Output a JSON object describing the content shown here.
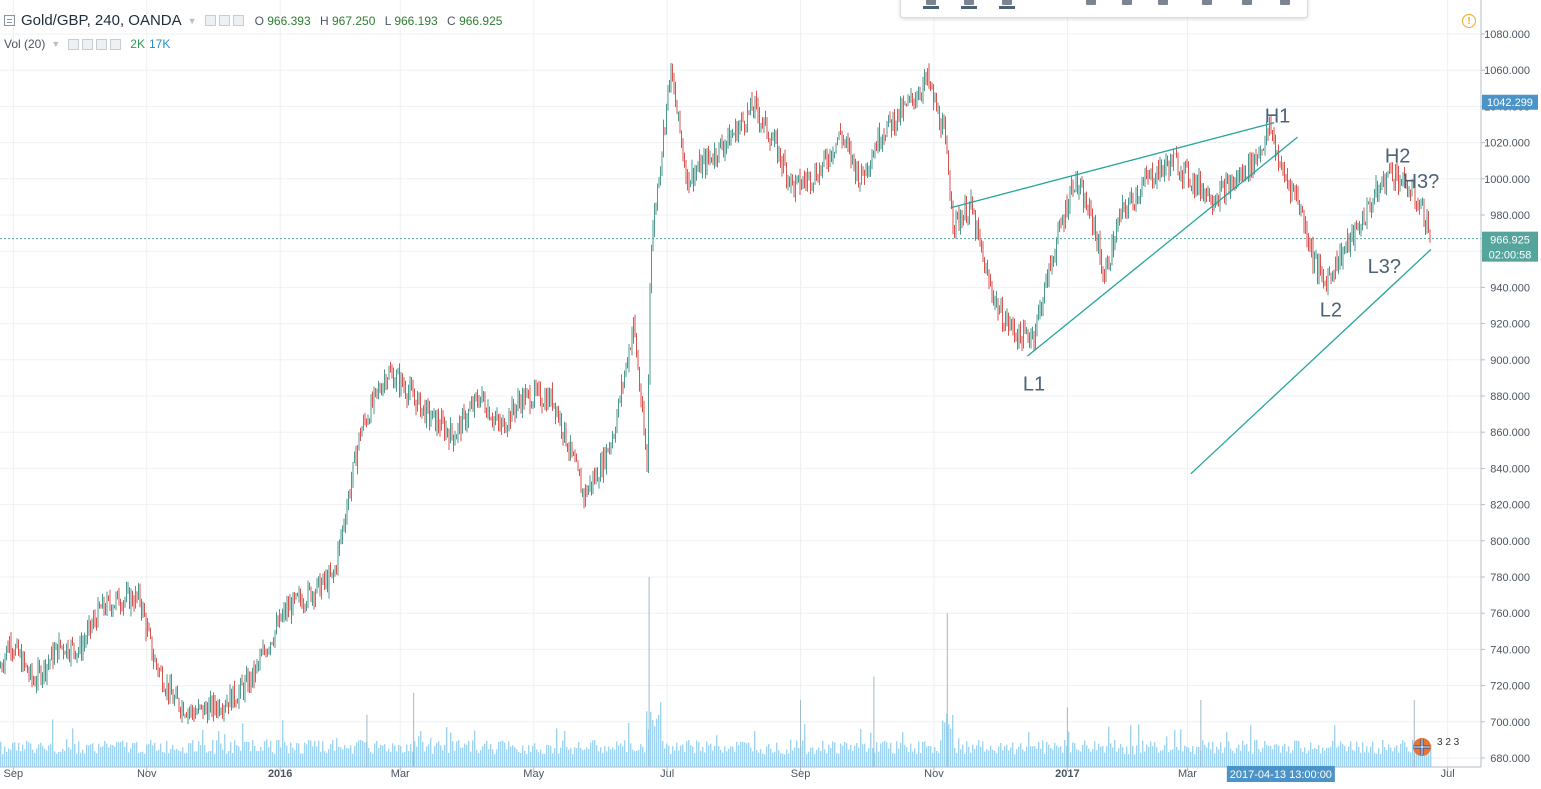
{
  "header": {
    "symbol": "Gold/GBP, 240, OANDA",
    "ohlc": [
      {
        "label": "O",
        "value": "966.393"
      },
      {
        "label": "H",
        "value": "967.250"
      },
      {
        "label": "L",
        "value": "966.193"
      },
      {
        "label": "C",
        "value": "966.925"
      }
    ],
    "volume_label": "Vol (20)",
    "volume_value_a": "2K",
    "volume_value_b": "17K",
    "toolbar_value": "20"
  },
  "price_axis": {
    "current_price": "966.925",
    "countdown": "02:00:58",
    "marker_price": "1042.299"
  },
  "time_axis": {
    "crosshair_label": "2017-04-13 13:00:00"
  },
  "events_badge": "3 2 3",
  "colors": {
    "up_candle": "#4e9a8f",
    "down_candle": "#d9534f",
    "trendline": "#26a69a",
    "price_tag": "#4c93c7",
    "last_price_tag": "#55a59c",
    "volume": "#7ec6ec",
    "annotation_text": "#4c6277",
    "alert": "#f5a623"
  },
  "chart_data": {
    "type": "candlestick",
    "title": "Gold/GBP, 240, OANDA",
    "ylim": [
      670,
      1090
    ],
    "y_ticks": [
      "680.000",
      "700.000",
      "720.000",
      "740.000",
      "760.000",
      "780.000",
      "800.000",
      "820.000",
      "840.000",
      "860.000",
      "880.000",
      "900.000",
      "920.000",
      "940.000",
      "960.000",
      "980.000",
      "1000.000",
      "1020.000",
      "1040.000",
      "1060.000",
      "1080.000"
    ],
    "x_ticks": [
      {
        "t": 0.2,
        "label": "Sep"
      },
      {
        "t": 2.2,
        "label": "Nov"
      },
      {
        "t": 4.2,
        "label": "2016"
      },
      {
        "t": 6.0,
        "label": "Mar"
      },
      {
        "t": 8.0,
        "label": "May"
      },
      {
        "t": 10.0,
        "label": "Jul"
      },
      {
        "t": 12.0,
        "label": "Sep"
      },
      {
        "t": 14.0,
        "label": "Nov"
      },
      {
        "t": 16.0,
        "label": "2017"
      },
      {
        "t": 17.8,
        "label": "Mar"
      },
      {
        "t": 21.7,
        "label": "Jul"
      }
    ],
    "crosshair_t": 19.2,
    "last_price": 966.925,
    "price_series": [
      {
        "t": 0.0,
        "p": 730
      },
      {
        "t": 0.15,
        "p": 745
      },
      {
        "t": 0.5,
        "p": 722
      },
      {
        "t": 0.9,
        "p": 742
      },
      {
        "t": 1.2,
        "p": 740
      },
      {
        "t": 1.5,
        "p": 762
      },
      {
        "t": 1.8,
        "p": 768
      },
      {
        "t": 2.1,
        "p": 768
      },
      {
        "t": 2.3,
        "p": 735
      },
      {
        "t": 2.6,
        "p": 712
      },
      {
        "t": 2.9,
        "p": 705
      },
      {
        "t": 3.2,
        "p": 708
      },
      {
        "t": 3.55,
        "p": 715
      },
      {
        "t": 3.8,
        "p": 725
      },
      {
        "t": 4.0,
        "p": 742
      },
      {
        "t": 4.3,
        "p": 762
      },
      {
        "t": 4.6,
        "p": 770
      },
      {
        "t": 5.0,
        "p": 780
      },
      {
        "t": 5.4,
        "p": 860
      },
      {
        "t": 5.8,
        "p": 893
      },
      {
        "t": 6.0,
        "p": 888
      },
      {
        "t": 6.4,
        "p": 870
      },
      {
        "t": 6.8,
        "p": 858
      },
      {
        "t": 7.2,
        "p": 880
      },
      {
        "t": 7.5,
        "p": 862
      },
      {
        "t": 7.8,
        "p": 878
      },
      {
        "t": 8.0,
        "p": 880
      },
      {
        "t": 8.3,
        "p": 878
      },
      {
        "t": 8.5,
        "p": 855
      },
      {
        "t": 8.75,
        "p": 825
      },
      {
        "t": 9.0,
        "p": 840
      },
      {
        "t": 9.2,
        "p": 860
      },
      {
        "t": 9.5,
        "p": 920
      },
      {
        "t": 9.7,
        "p": 840
      },
      {
        "t": 9.75,
        "p": 960
      },
      {
        "t": 9.9,
        "p": 1010
      },
      {
        "t": 10.05,
        "p": 1060
      },
      {
        "t": 10.3,
        "p": 1000
      },
      {
        "t": 10.6,
        "p": 1010
      },
      {
        "t": 11.0,
        "p": 1025
      },
      {
        "t": 11.3,
        "p": 1040
      },
      {
        "t": 11.6,
        "p": 1020
      },
      {
        "t": 11.9,
        "p": 995
      },
      {
        "t": 12.3,
        "p": 1005
      },
      {
        "t": 12.6,
        "p": 1025
      },
      {
        "t": 12.9,
        "p": 1000
      },
      {
        "t": 13.2,
        "p": 1025
      },
      {
        "t": 13.6,
        "p": 1040
      },
      {
        "t": 13.9,
        "p": 1055
      },
      {
        "t": 14.15,
        "p": 1025
      },
      {
        "t": 14.3,
        "p": 975
      },
      {
        "t": 14.55,
        "p": 985
      },
      {
        "t": 14.8,
        "p": 945
      },
      {
        "t": 15.0,
        "p": 925
      },
      {
        "t": 15.3,
        "p": 912
      },
      {
        "t": 15.5,
        "p": 915
      },
      {
        "t": 15.8,
        "p": 960
      },
      {
        "t": 16.1,
        "p": 1000
      },
      {
        "t": 16.4,
        "p": 975
      },
      {
        "t": 16.55,
        "p": 945
      },
      {
        "t": 16.8,
        "p": 980
      },
      {
        "t": 17.2,
        "p": 1000
      },
      {
        "t": 17.6,
        "p": 1010
      },
      {
        "t": 17.9,
        "p": 998
      },
      {
        "t": 18.2,
        "p": 990
      },
      {
        "t": 18.5,
        "p": 998
      },
      {
        "t": 18.8,
        "p": 1010
      },
      {
        "t": 19.05,
        "p": 1028
      },
      {
        "t": 19.2,
        "p": 1005
      },
      {
        "t": 19.45,
        "p": 990
      },
      {
        "t": 19.7,
        "p": 955
      },
      {
        "t": 19.85,
        "p": 942
      },
      {
        "t": 20.1,
        "p": 958
      },
      {
        "t": 20.35,
        "p": 972
      },
      {
        "t": 20.6,
        "p": 990
      },
      {
        "t": 20.85,
        "p": 1005
      },
      {
        "t": 21.1,
        "p": 995
      },
      {
        "t": 21.3,
        "p": 985
      },
      {
        "t": 21.45,
        "p": 968
      }
    ],
    "volume_spikes": [
      {
        "t": 9.73,
        "v": 780
      },
      {
        "t": 14.2,
        "v": 760
      },
      {
        "t": 12.0,
        "v": 712
      },
      {
        "t": 13.1,
        "v": 725
      },
      {
        "t": 18.0,
        "v": 712
      },
      {
        "t": 16.0,
        "v": 708
      },
      {
        "t": 21.2,
        "v": 712
      },
      {
        "t": 5.5,
        "v": 704
      },
      {
        "t": 6.2,
        "v": 716
      }
    ],
    "trendlines": [
      {
        "t1": 14.25,
        "p1": 984,
        "t2": 19.1,
        "p2": 1031
      },
      {
        "t1": 15.4,
        "p1": 902,
        "t2": 19.45,
        "p2": 1023
      },
      {
        "t1": 17.85,
        "p1": 837,
        "t2": 21.45,
        "p2": 961
      }
    ],
    "annotations": [
      {
        "label": "H1",
        "t": 19.15,
        "p": 1031
      },
      {
        "label": "L1",
        "t": 15.5,
        "p": 883
      },
      {
        "label": "H2",
        "t": 20.95,
        "p": 1009
      },
      {
        "label": "H3?",
        "t": 21.3,
        "p": 995
      },
      {
        "label": "L2",
        "t": 19.95,
        "p": 924
      },
      {
        "label": "L3?",
        "t": 20.75,
        "p": 948
      }
    ]
  }
}
